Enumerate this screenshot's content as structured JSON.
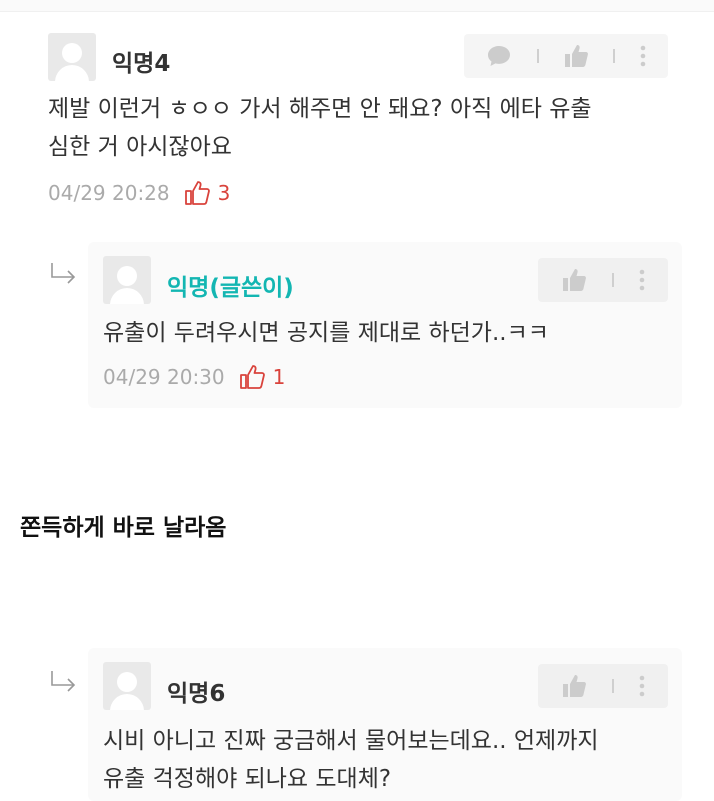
{
  "comments": [
    {
      "author": "익명4",
      "lines": [
        "제발 이런거 ㅎㅇㅇ 가서 해주면 안 돼요? 아직 에타 유출",
        "심한 거 아시잖아요"
      ],
      "timestamp": "04/29 20:28",
      "likes": "3"
    },
    {
      "author": "익명(글쓴이)",
      "lines": [
        "유출이 두려우시면 공지를 제대로 하던가..ㅋㅋ"
      ],
      "timestamp": "04/29 20:30",
      "likes": "1"
    },
    {
      "author": "익명6",
      "lines": [
        "시비 아니고 진짜 궁금해서 물어보는데요.. 언제까지",
        "유출 걱정해야 되나요 도대체?"
      ]
    }
  ],
  "caption": "쫀득하게 바로 날라옴",
  "colors": {
    "like": "#d9433c",
    "writer": "#13b6b2",
    "meta": "#aaaaaa",
    "action_icon": "#cccccc"
  },
  "icons": [
    "reply-icon",
    "thumbs-up-icon",
    "more-icon",
    "like-icon",
    "reply-arrow-icon"
  ]
}
